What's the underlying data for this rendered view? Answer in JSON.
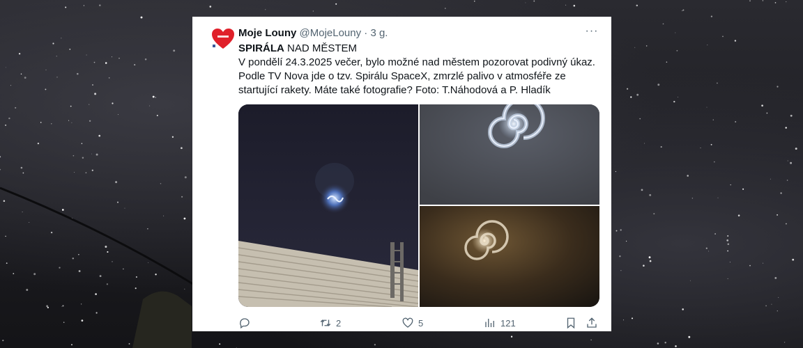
{
  "tweet": {
    "author_name": "Moje Louny",
    "handle": "@MojeLouny",
    "separator": "·",
    "time": "3 g.",
    "more_label": "···",
    "title_bold": "SPIRÁLA",
    "title_rest": " NAD MĚSTEM",
    "body": "V pondělí 24.3.2025 večer, bylo možné nad městem pozorovat podivný úkaz. Podle TV Nova jde o tzv. Spirálu SpaceX, zmrzlé palivo v atmosféře ze startující rakety. Máte také fotografie? Foto: T.Náhodová a P. Hladík"
  },
  "actions": {
    "reply_count": "",
    "retweet_count": "2",
    "like_count": "5",
    "views_count": "121"
  },
  "colors": {
    "text_primary": "#0f1419",
    "text_secondary": "#536471",
    "avatar_heart": "#e0202a"
  },
  "icons": [
    "reply-icon",
    "retweet-icon",
    "like-icon",
    "views-icon",
    "bookmark-icon",
    "share-icon",
    "more-icon"
  ]
}
